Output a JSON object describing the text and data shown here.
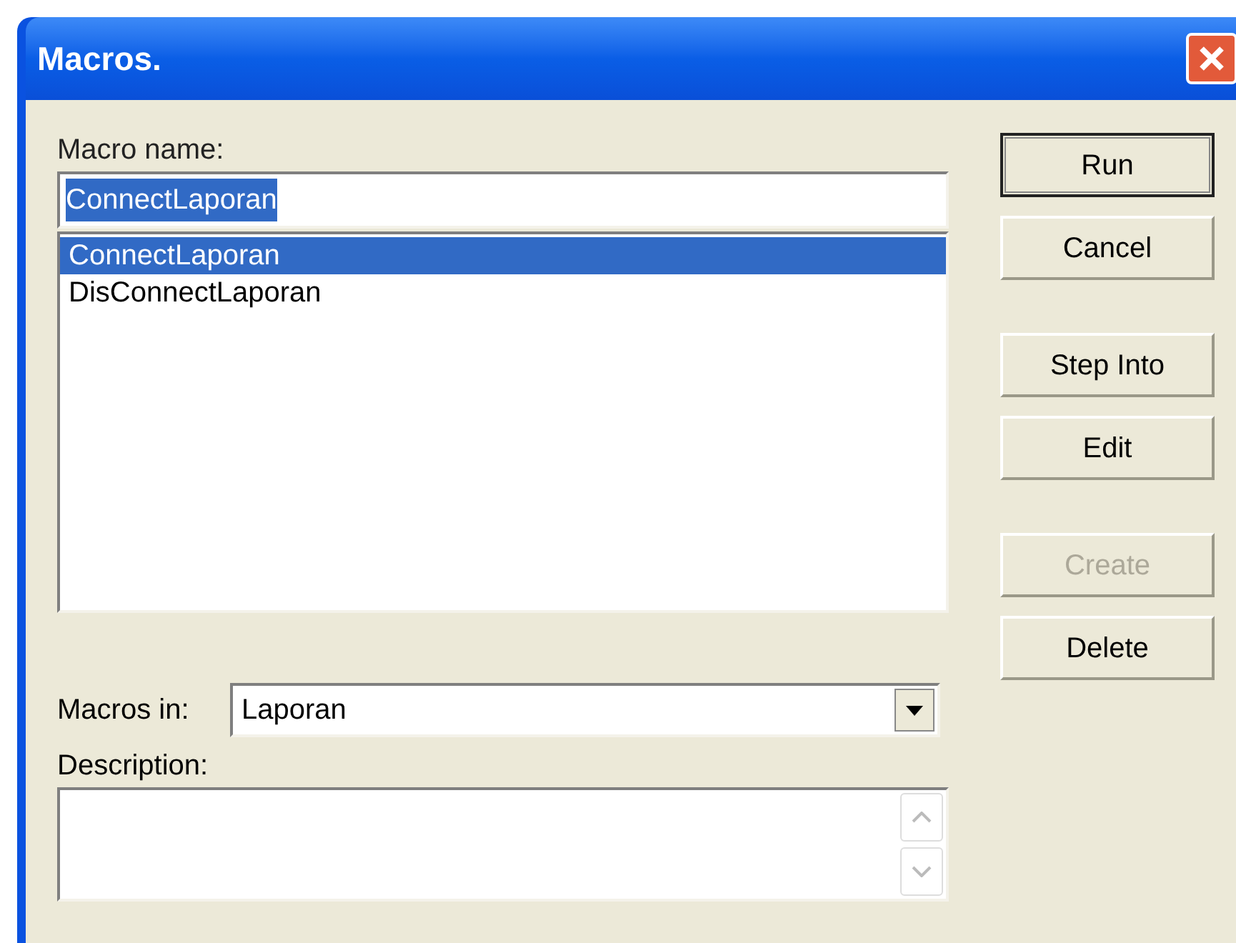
{
  "window": {
    "title": "Macros."
  },
  "macro_name": {
    "label": "Macro name:",
    "value": "ConnectLaporan",
    "text_selected": true
  },
  "macro_list": [
    {
      "label": "ConnectLaporan",
      "selected": true
    },
    {
      "label": "DisConnectLaporan",
      "selected": false
    }
  ],
  "macros_in": {
    "label": "Macros in:",
    "value": "Laporan"
  },
  "description": {
    "label": "Description:"
  },
  "button_groups": [
    [
      {
        "label": "Run",
        "default": true,
        "disabled": false
      },
      {
        "label": "Cancel",
        "default": false,
        "disabled": false
      }
    ],
    [
      {
        "label": "Step Into",
        "default": false,
        "disabled": false
      },
      {
        "label": "Edit",
        "default": false,
        "disabled": false
      }
    ],
    [
      {
        "label": "Create",
        "default": false,
        "disabled": true
      },
      {
        "label": "Delete",
        "default": false,
        "disabled": false
      }
    ]
  ]
}
